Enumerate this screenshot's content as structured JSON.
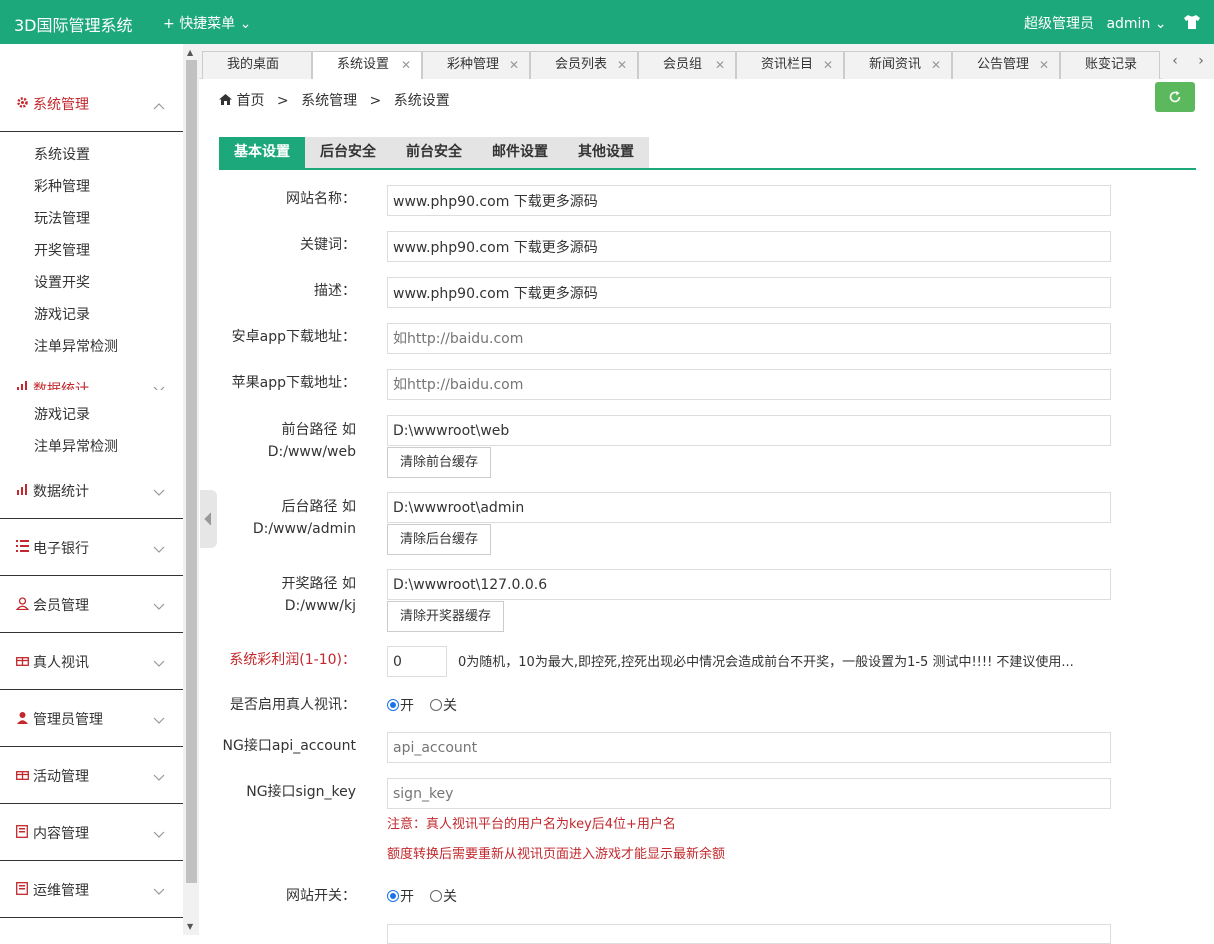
{
  "app": {
    "title": "3D国际管理系统",
    "quick_menu": "快捷菜单",
    "user_role": "超级管理员",
    "user_name": "admin"
  },
  "sidebar": {
    "groups": [
      {
        "label": "系统管理",
        "icon": "gear-icon",
        "active": true,
        "items": [
          "系统设置",
          "彩种管理",
          "玩法管理",
          "开奖管理",
          "设置开奖",
          "游戏记录",
          "注单异常检测"
        ]
      },
      {
        "label": "数据统计",
        "icon": "chart-icon",
        "items": [
          "游戏记录",
          "注单异常检测"
        ]
      },
      {
        "label": "数据统计",
        "icon": "chart-icon"
      },
      {
        "label": "电子银行",
        "icon": "list-icon"
      },
      {
        "label": "会员管理",
        "icon": "user-icon"
      },
      {
        "label": "真人视讯",
        "icon": "gift-icon"
      },
      {
        "label": "管理员管理",
        "icon": "user-solid-icon"
      },
      {
        "label": "活动管理",
        "icon": "gift-icon"
      },
      {
        "label": "内容管理",
        "icon": "book-icon"
      },
      {
        "label": "运维管理",
        "icon": "book-icon"
      }
    ]
  },
  "tabs": [
    {
      "label": "我的桌面",
      "closable": false
    },
    {
      "label": "系统设置",
      "closable": true,
      "active": true
    },
    {
      "label": "彩种管理",
      "closable": true
    },
    {
      "label": "会员列表",
      "closable": true
    },
    {
      "label": "会员组",
      "closable": true
    },
    {
      "label": "资讯栏目",
      "closable": true
    },
    {
      "label": "新闻资讯",
      "closable": true
    },
    {
      "label": "公告管理",
      "closable": true
    },
    {
      "label": "账变记录",
      "closable": false
    }
  ],
  "breadcrumb": {
    "home": "首页",
    "sep": ">",
    "level1": "系统管理",
    "level2": "系统设置"
  },
  "settings_tabs": [
    "基本设置",
    "后台安全",
    "前台安全",
    "邮件设置",
    "其他设置"
  ],
  "form": {
    "site_name": {
      "label": "网站名称：",
      "value": "www.php90.com 下载更多源码"
    },
    "keywords": {
      "label": "关键词：",
      "value": "www.php90.com 下载更多源码"
    },
    "description": {
      "label": "描述：",
      "value": "www.php90.com 下载更多源码"
    },
    "android_url": {
      "label": "安卓app下载地址：",
      "placeholder": "如http://baidu.com"
    },
    "ios_url": {
      "label": "苹果app下载地址：",
      "placeholder": "如http://baidu.com"
    },
    "front_path": {
      "label": "前台路径 如",
      "label2": "D:/www/web",
      "value": "D:\\wwwroot\\web",
      "button": "清除前台缓存"
    },
    "admin_path": {
      "label": "后台路径 如",
      "label2": "D:/www/admin",
      "value": "D:\\wwwroot\\admin",
      "button": "清除后台缓存"
    },
    "lottery_path": {
      "label": "开奖路径 如",
      "label2": "D:/www/kj",
      "value": "D:\\wwwroot\\127.0.0.6",
      "button": "清除开奖器缓存"
    },
    "profit": {
      "label": "系统彩利润(1-10)：",
      "value": "0",
      "hint": "0为随机，10为最大,即控死,控死出现必中情况会造成前台不开奖，一般设置为1-5 测试中!!!! 不建议使用..."
    },
    "live_video": {
      "label": "是否启用真人视讯：",
      "on": "开",
      "off": "关",
      "selected": "on"
    },
    "ng_account": {
      "label": "NG接口api_account",
      "placeholder": "api_account"
    },
    "ng_key": {
      "label": "NG接口sign_key",
      "placeholder": "sign_key"
    },
    "note1": "注意：真人视讯平台的用户名为key后4位+用户名",
    "note2": "额度转换后需要重新从视讯页面进入游戏才能显示最新余额",
    "site_switch": {
      "label": "网站开关：",
      "on": "开",
      "off": "关",
      "selected": "on"
    }
  },
  "colors": {
    "brand": "#1ca87a",
    "accent_red": "#c2282d",
    "refresh_btn": "#5cb85c"
  }
}
